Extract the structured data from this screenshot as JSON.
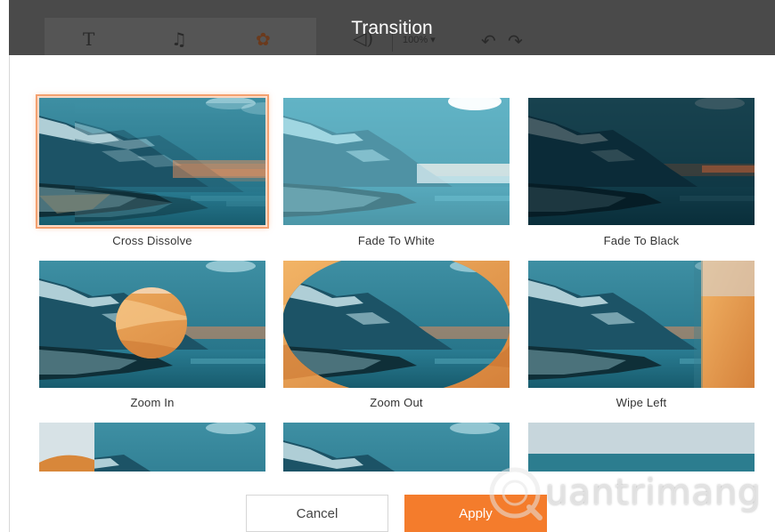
{
  "window": {
    "title": "Transition"
  },
  "toolbar": {
    "text_icon": "text-tool-icon",
    "music_icon": "music-note-icon",
    "settings_icon": "gear-icon",
    "volume_icon": "speaker-icon",
    "zoom_label": "100%",
    "undo_icon": "undo-icon",
    "redo_icon": "redo-icon"
  },
  "transitions": [
    {
      "label": "Cross Dissolve",
      "selected": true
    },
    {
      "label": "Fade To White",
      "selected": false
    },
    {
      "label": "Fade To Black",
      "selected": false
    },
    {
      "label": "Zoom In",
      "selected": false
    },
    {
      "label": "Zoom Out",
      "selected": false
    },
    {
      "label": "Wipe Left",
      "selected": false
    },
    {
      "label": "",
      "selected": false
    },
    {
      "label": "",
      "selected": false
    },
    {
      "label": "",
      "selected": false
    }
  ],
  "buttons": {
    "cancel": "Cancel",
    "apply": "Apply"
  },
  "watermark": {
    "text": "uantrimang"
  },
  "colors": {
    "accent": "#f47c2c",
    "selection_glow": "#f4a170",
    "topbar": "#4a4a4a"
  }
}
